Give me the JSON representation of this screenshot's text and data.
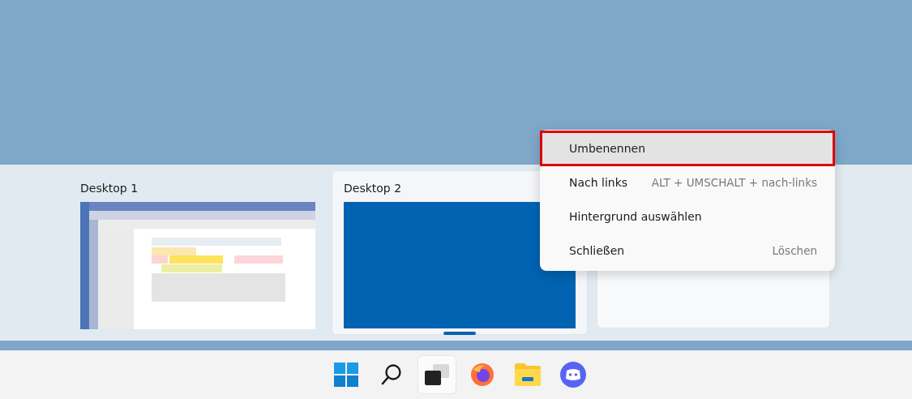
{
  "desktops": [
    {
      "title": "Desktop 1",
      "selected": false,
      "kind": "screenshot"
    },
    {
      "title": "Desktop 2",
      "selected": true,
      "kind": "solid"
    },
    {
      "selected": false,
      "kind": "blank"
    }
  ],
  "context_menu": {
    "items": [
      {
        "label": "Umbenennen",
        "highlighted": true
      },
      {
        "label": "Nach links",
        "shortcut": "ALT + UMSCHALT + nach-links",
        "highlighted": false
      },
      {
        "label": "Hintergrund auswählen",
        "highlighted": false
      },
      {
        "label": "Schließen",
        "shortcut": "Löschen",
        "highlighted": false
      }
    ]
  },
  "taskbar": [
    {
      "kind": "start",
      "selected": false
    },
    {
      "kind": "search",
      "selected": false
    },
    {
      "kind": "taskview",
      "selected": true
    },
    {
      "kind": "browser",
      "selected": false
    },
    {
      "kind": "folder",
      "selected": false
    },
    {
      "kind": "chat",
      "selected": false
    }
  ]
}
